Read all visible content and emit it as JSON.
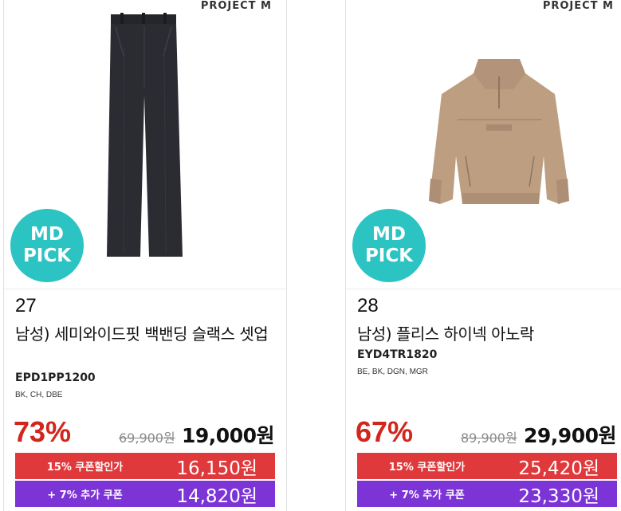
{
  "products": [
    {
      "brand": "PROJECT M",
      "badge": {
        "line1": "MD",
        "line2": "PICK"
      },
      "rank": "27",
      "name": "남성) 세미와이드핏 백밴딩 슬랙스 셋업",
      "code": "EPD1PP1200",
      "colors": "BK, CH, DBE",
      "discount": "73%",
      "original_price": "69,900원",
      "sale_price": "19,000원",
      "coupon": {
        "label": "15% 쿠폰할인가",
        "price": "16,150원",
        "color": "#e0393c"
      },
      "extra_coupon": {
        "label": "+ 7% 추가 쿠폰",
        "price": "14,820원",
        "color": "#7c34d6"
      },
      "image_icon": "pants-icon"
    },
    {
      "brand": "PROJECT M",
      "badge": {
        "line1": "MD",
        "line2": "PICK"
      },
      "rank": "28",
      "name": "남성) 플리스 하이넥 아노락",
      "code": "EYD4TR1820",
      "colors": "BE, BK, DGN, MGR",
      "discount": "67%",
      "original_price": "89,900원",
      "sale_price": "29,900원",
      "coupon": {
        "label": "15% 쿠폰할인가",
        "price": "25,420원",
        "color": "#e0393c"
      },
      "extra_coupon": {
        "label": "+ 7% 추가 쿠폰",
        "price": "23,330원",
        "color": "#7c34d6"
      },
      "image_icon": "anorak-icon"
    }
  ],
  "colors": {
    "badge": "#2cc3c3",
    "discount": "#d2261d"
  }
}
